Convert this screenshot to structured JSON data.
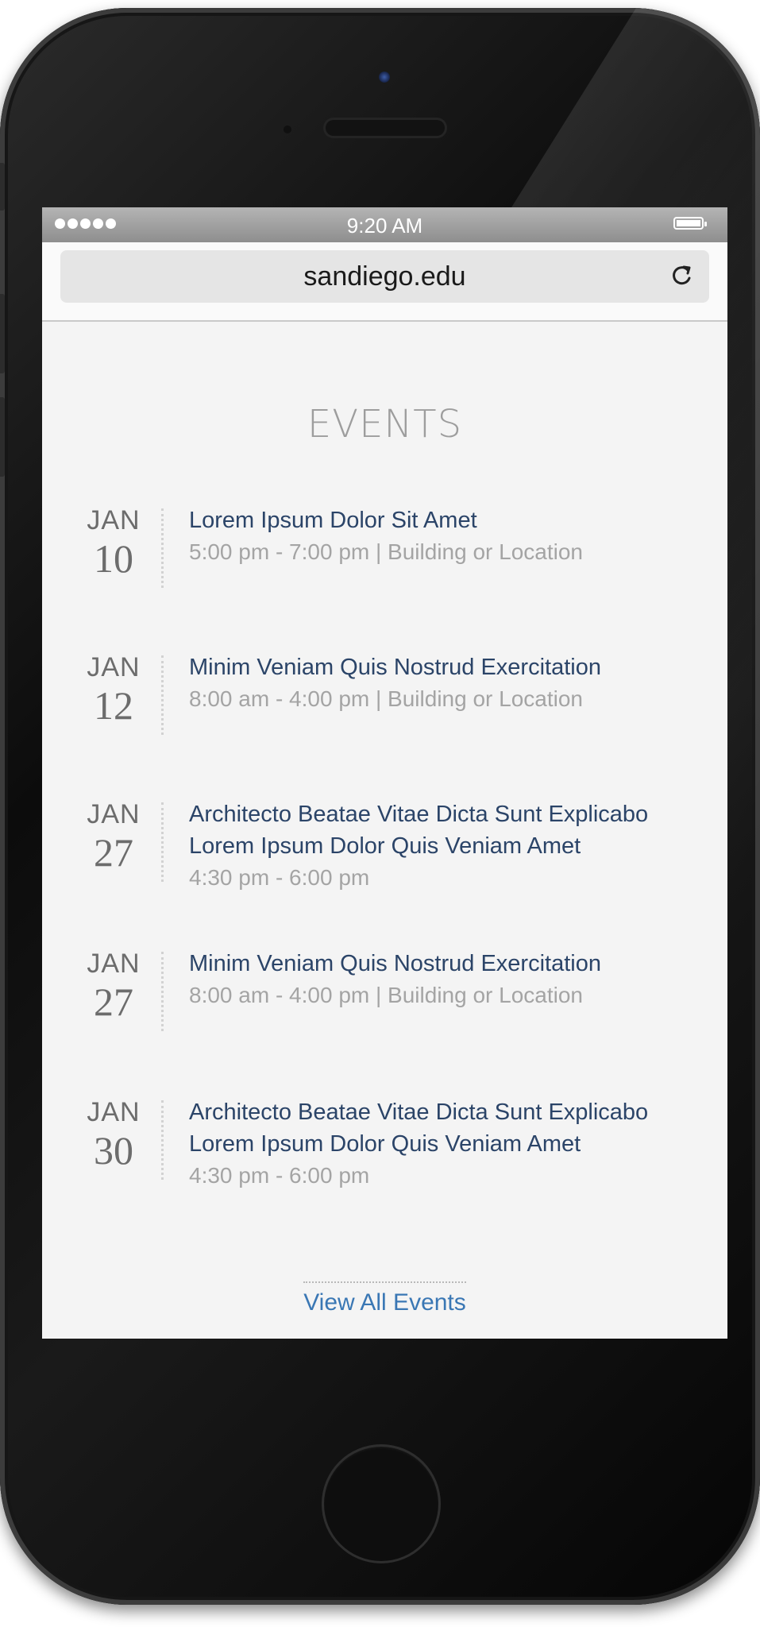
{
  "browser": {
    "status_time": "9:20 AM",
    "url": "sandiego.edu",
    "reload_icon": "reload-icon"
  },
  "page": {
    "heading": "EVENTS",
    "events": [
      {
        "month": "JAN",
        "day": "10",
        "title": "Lorem Ipsum Dolor Sit Amet",
        "meta": "5:00 pm - 7:00 pm  |  Building or Location"
      },
      {
        "month": "JAN",
        "day": "12",
        "title": "Minim Veniam Quis Nostrud Exercitation",
        "meta": "8:00 am - 4:00 pm  |  Building or Location"
      },
      {
        "month": "JAN",
        "day": "27",
        "title": "Architecto Beatae Vitae Dicta Sunt Explicabo Lorem Ipsum Dolor Quis Veniam  Amet",
        "meta": "4:30 pm - 6:00 pm"
      },
      {
        "month": "JAN",
        "day": "27",
        "title": "Minim Veniam Quis Nostrud Exercitation",
        "meta": "8:00 am - 4:00 pm  |  Building or Location"
      },
      {
        "month": "JAN",
        "day": "30",
        "title": "Architecto Beatae Vitae Dicta Sunt Explicabo Lorem Ipsum Dolor Quis Veniam  Amet",
        "meta": "4:30 pm - 6:00 pm"
      }
    ],
    "view_all": "View All Events"
  },
  "colors": {
    "title_blue": "#2b4468",
    "link_blue": "#3a77b4",
    "meta_gray": "#a4a4a4"
  }
}
